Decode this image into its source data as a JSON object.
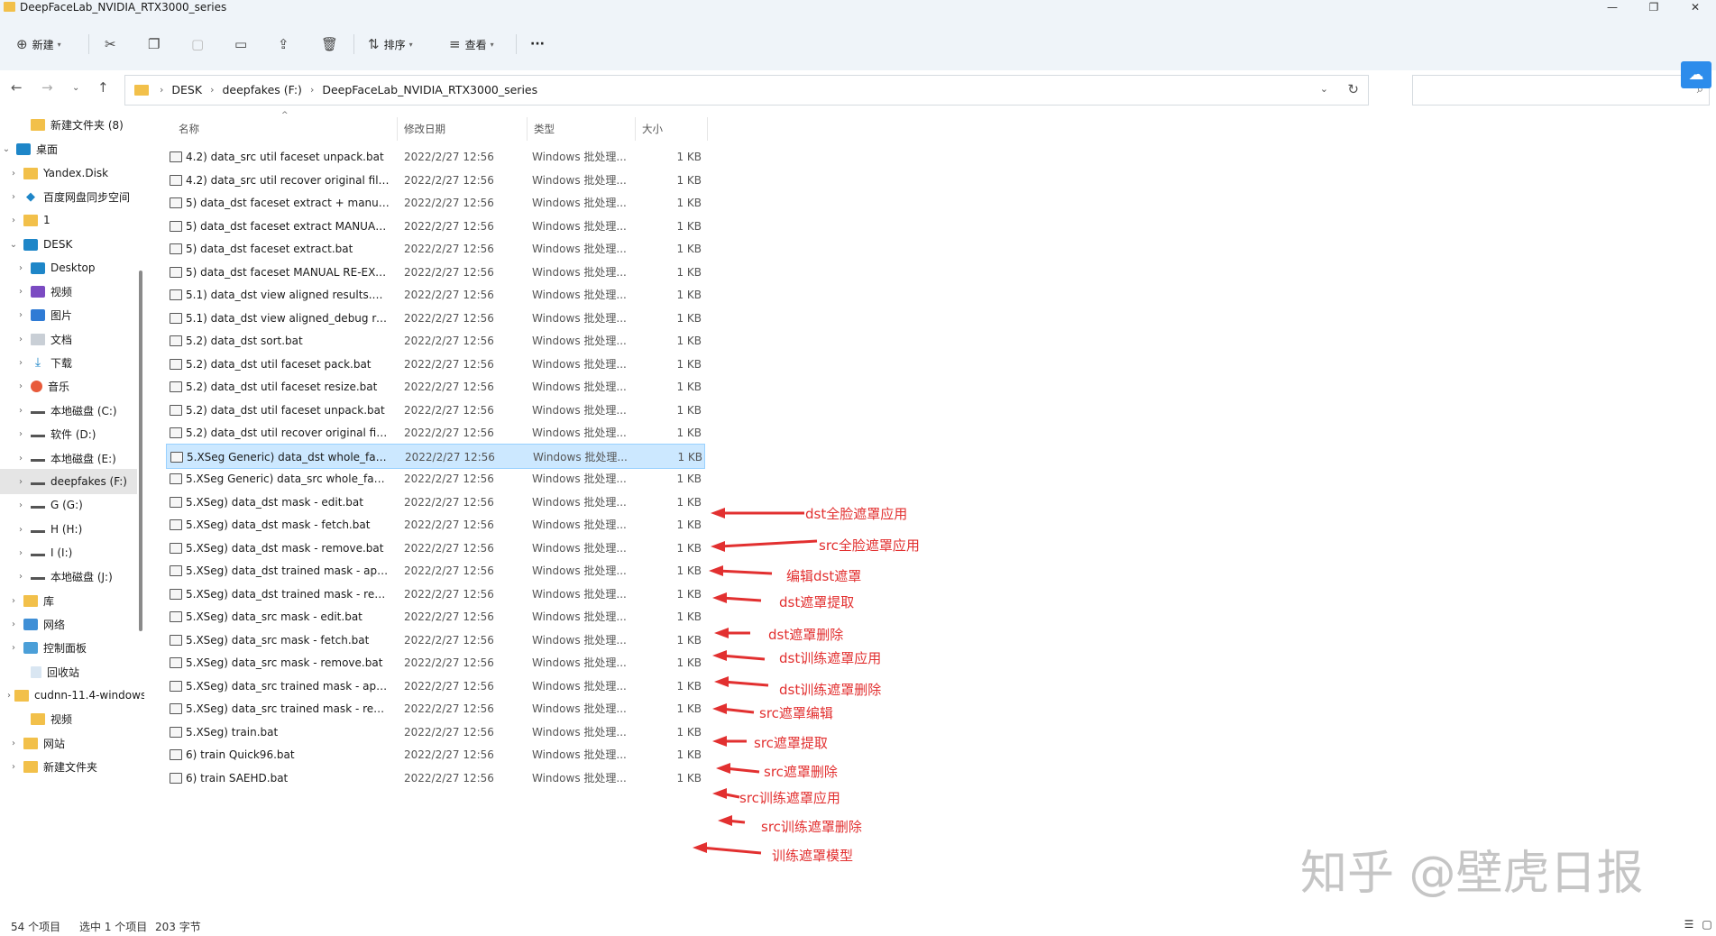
{
  "window": {
    "title": "DeepFaceLab_NVIDIA_RTX3000_series",
    "min": "—",
    "max": "❐",
    "close": "✕"
  },
  "toolbar": {
    "new_label": "新建",
    "sort_label": "排序",
    "view_label": "查看",
    "more_label": "···"
  },
  "address": {
    "crumbs": [
      "DESK",
      "deepfakes (F:)",
      "DeepFaceLab_NVIDIA_RTX3000_series"
    ],
    "search_placeholder": ""
  },
  "sidebar": {
    "items": [
      {
        "label": "新建文件夹 (8)",
        "icon": "folder"
      },
      {
        "label": "桌面",
        "icon": "desktop"
      },
      {
        "label": "Yandex.Disk",
        "icon": "folder"
      },
      {
        "label": "百度网盘同步空间",
        "icon": "baidu"
      },
      {
        "label": "1",
        "icon": "folder"
      },
      {
        "label": "DESK",
        "icon": "pc"
      },
      {
        "label": "Desktop",
        "icon": "desktop"
      },
      {
        "label": "视频",
        "icon": "video"
      },
      {
        "label": "图片",
        "icon": "picture"
      },
      {
        "label": "文档",
        "icon": "document"
      },
      {
        "label": "下载",
        "icon": "download"
      },
      {
        "label": "音乐",
        "icon": "music"
      },
      {
        "label": "本地磁盘 (C:)",
        "icon": "drive-c"
      },
      {
        "label": "软件 (D:)",
        "icon": "drive"
      },
      {
        "label": "本地磁盘 (E:)",
        "icon": "drive"
      },
      {
        "label": "deepfakes (F:)",
        "icon": "drive"
      },
      {
        "label": "G (G:)",
        "icon": "drive"
      },
      {
        "label": "H (H:)",
        "icon": "drive"
      },
      {
        "label": "I (I:)",
        "icon": "drive"
      },
      {
        "label": "本地磁盘 (J:)",
        "icon": "drive"
      },
      {
        "label": "库",
        "icon": "folder"
      },
      {
        "label": "网络",
        "icon": "network"
      },
      {
        "label": "控制面板",
        "icon": "control-panel"
      },
      {
        "label": "回收站",
        "icon": "recycle-bin"
      },
      {
        "label": "cudnn-11.4-windows",
        "icon": "folder"
      },
      {
        "label": "视频",
        "icon": "folder"
      },
      {
        "label": "网站",
        "icon": "folder"
      },
      {
        "label": "新建文件夹",
        "icon": "folder"
      }
    ]
  },
  "columns": {
    "name": "名称",
    "modified": "修改日期",
    "type": "类型",
    "size": "大小"
  },
  "files": [
    {
      "name": "4.2) data_src util faceset unpack.bat",
      "date": "2022/2/27 12:56",
      "type": "Windows 批处理...",
      "size": "1 KB"
    },
    {
      "name": "4.2) data_src util recover original file...",
      "date": "2022/2/27 12:56",
      "type": "Windows 批处理...",
      "size": "1 KB"
    },
    {
      "name": "5) data_dst faceset extract + manual ...",
      "date": "2022/2/27 12:56",
      "type": "Windows 批处理...",
      "size": "1 KB"
    },
    {
      "name": "5) data_dst faceset extract MANUAL....",
      "date": "2022/2/27 12:56",
      "type": "Windows 批处理...",
      "size": "1 KB"
    },
    {
      "name": "5) data_dst faceset extract.bat",
      "date": "2022/2/27 12:56",
      "type": "Windows 批处理...",
      "size": "1 KB"
    },
    {
      "name": "5) data_dst faceset MANUAL RE-EXT...",
      "date": "2022/2/27 12:56",
      "type": "Windows 批处理...",
      "size": "1 KB"
    },
    {
      "name": "5.1) data_dst view aligned results.bat",
      "date": "2022/2/27 12:56",
      "type": "Windows 批处理...",
      "size": "1 KB"
    },
    {
      "name": "5.1) data_dst view aligned_debug res...",
      "date": "2022/2/27 12:56",
      "type": "Windows 批处理...",
      "size": "1 KB"
    },
    {
      "name": "5.2) data_dst sort.bat",
      "date": "2022/2/27 12:56",
      "type": "Windows 批处理...",
      "size": "1 KB"
    },
    {
      "name": "5.2) data_dst util faceset pack.bat",
      "date": "2022/2/27 12:56",
      "type": "Windows 批处理...",
      "size": "1 KB"
    },
    {
      "name": "5.2) data_dst util faceset resize.bat",
      "date": "2022/2/27 12:56",
      "type": "Windows 批处理...",
      "size": "1 KB"
    },
    {
      "name": "5.2) data_dst util faceset unpack.bat",
      "date": "2022/2/27 12:56",
      "type": "Windows 批处理...",
      "size": "1 KB"
    },
    {
      "name": "5.2) data_dst util recover original file...",
      "date": "2022/2/27 12:56",
      "type": "Windows 批处理...",
      "size": "1 KB"
    },
    {
      "name": "5.XSeg Generic) data_dst whole_face ...",
      "date": "2022/2/27 12:56",
      "type": "Windows 批处理...",
      "size": "1 KB",
      "selected": true
    },
    {
      "name": "5.XSeg Generic) data_src whole_face ...",
      "date": "2022/2/27 12:56",
      "type": "Windows 批处理...",
      "size": "1 KB"
    },
    {
      "name": "5.XSeg) data_dst mask - edit.bat",
      "date": "2022/2/27 12:56",
      "type": "Windows 批处理...",
      "size": "1 KB"
    },
    {
      "name": "5.XSeg) data_dst mask - fetch.bat",
      "date": "2022/2/27 12:56",
      "type": "Windows 批处理...",
      "size": "1 KB"
    },
    {
      "name": "5.XSeg) data_dst mask - remove.bat",
      "date": "2022/2/27 12:56",
      "type": "Windows 批处理...",
      "size": "1 KB"
    },
    {
      "name": "5.XSeg) data_dst trained mask - appl...",
      "date": "2022/2/27 12:56",
      "type": "Windows 批处理...",
      "size": "1 KB"
    },
    {
      "name": "5.XSeg) data_dst trained mask - rem...",
      "date": "2022/2/27 12:56",
      "type": "Windows 批处理...",
      "size": "1 KB"
    },
    {
      "name": "5.XSeg) data_src mask - edit.bat",
      "date": "2022/2/27 12:56",
      "type": "Windows 批处理...",
      "size": "1 KB"
    },
    {
      "name": "5.XSeg) data_src mask - fetch.bat",
      "date": "2022/2/27 12:56",
      "type": "Windows 批处理...",
      "size": "1 KB"
    },
    {
      "name": "5.XSeg) data_src mask - remove.bat",
      "date": "2022/2/27 12:56",
      "type": "Windows 批处理...",
      "size": "1 KB"
    },
    {
      "name": "5.XSeg) data_src trained mask - appl...",
      "date": "2022/2/27 12:56",
      "type": "Windows 批处理...",
      "size": "1 KB"
    },
    {
      "name": "5.XSeg) data_src trained mask - rem...",
      "date": "2022/2/27 12:56",
      "type": "Windows 批处理...",
      "size": "1 KB"
    },
    {
      "name": "5.XSeg) train.bat",
      "date": "2022/2/27 12:56",
      "type": "Windows 批处理...",
      "size": "1 KB"
    },
    {
      "name": "6) train Quick96.bat",
      "date": "2022/2/27 12:56",
      "type": "Windows 批处理...",
      "size": "1 KB"
    },
    {
      "name": "6) train SAEHD.bat",
      "date": "2022/2/27 12:56",
      "type": "Windows 批处理...",
      "size": "1 KB"
    }
  ],
  "annotations": [
    "dst全脸遮罩应用",
    "src全脸遮罩应用",
    "编辑dst遮罩",
    "dst遮罩提取",
    "dst遮罩删除",
    "dst训练遮罩应用",
    "dst训练遮罩删除",
    "src遮罩编辑",
    "src遮罩提取",
    "src遮罩删除",
    "src训练遮罩应用",
    "src训练遮罩删除",
    "训练遮罩模型"
  ],
  "annotation_color": "#e23030",
  "watermark": "知乎 @壁虎日报",
  "status": {
    "count": "54 个项目",
    "selected": "选中 1 个项目",
    "size": "203 字节"
  }
}
